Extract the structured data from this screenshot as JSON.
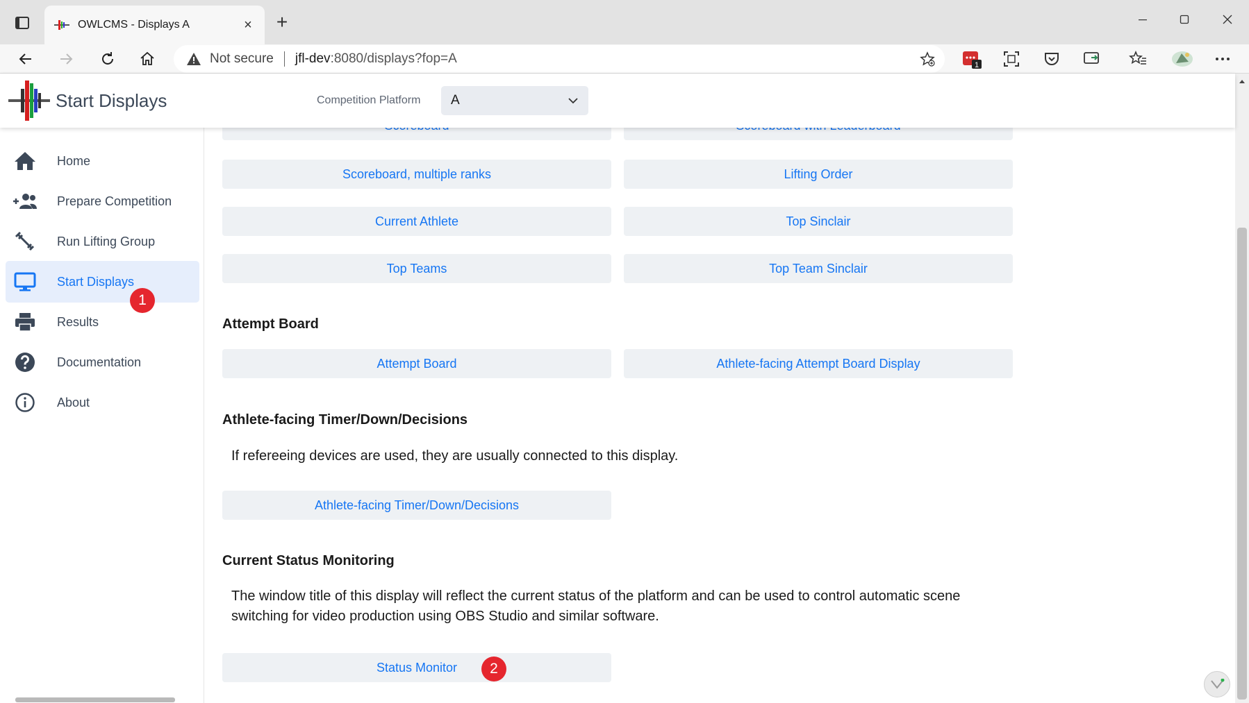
{
  "browser": {
    "tab_title": "OWLCMS - Displays A",
    "address_security": "Not secure",
    "address_host": "jfl-dev",
    "address_path": ":8080/displays?fop=A",
    "extension_badge": "1"
  },
  "header": {
    "app_title": "Start Displays",
    "platform_label": "Competition Platform",
    "platform_value": "A"
  },
  "sidebar": {
    "items": [
      {
        "label": "Home",
        "icon": "home-icon"
      },
      {
        "label": "Prepare Competition",
        "icon": "group-add-icon"
      },
      {
        "label": "Run Lifting Group",
        "icon": "barbell-icon"
      },
      {
        "label": "Start Displays",
        "icon": "monitor-icon",
        "active": true
      },
      {
        "label": "Results",
        "icon": "printer-icon"
      },
      {
        "label": "Documentation",
        "icon": "help-icon"
      },
      {
        "label": "About",
        "icon": "info-icon"
      }
    ]
  },
  "annotations": {
    "badge1": "1",
    "badge2": "2",
    "badge_color": "#e5262e"
  },
  "main": {
    "partial_buttons": [
      "Scoreboard",
      "Scoreboard with Leaderboard"
    ],
    "scoreboard_buttons": [
      "Scoreboard, multiple ranks",
      "Lifting Order",
      "Current Athlete",
      "Top Sinclair",
      "Top Teams",
      "Top Team Sinclair"
    ],
    "attempt_board": {
      "heading": "Attempt Board",
      "buttons": [
        "Attempt Board",
        "Athlete-facing Attempt Board Display"
      ]
    },
    "timer": {
      "heading": "Athlete-facing Timer/Down/Decisions",
      "text": "If refereeing devices are used, they are usually connected to this display.",
      "button": "Athlete-facing Timer/Down/Decisions"
    },
    "status": {
      "heading": "Current Status Monitoring",
      "text": "The window title of this display will reflect the current status of the platform and can be used to control automatic scene switching for video production using OBS Studio and similar software.",
      "button": "Status Monitor"
    }
  },
  "colors": {
    "accent": "#1676f3",
    "button_bg": "#eef1f4",
    "active_nav_bg": "#e6eefc"
  }
}
